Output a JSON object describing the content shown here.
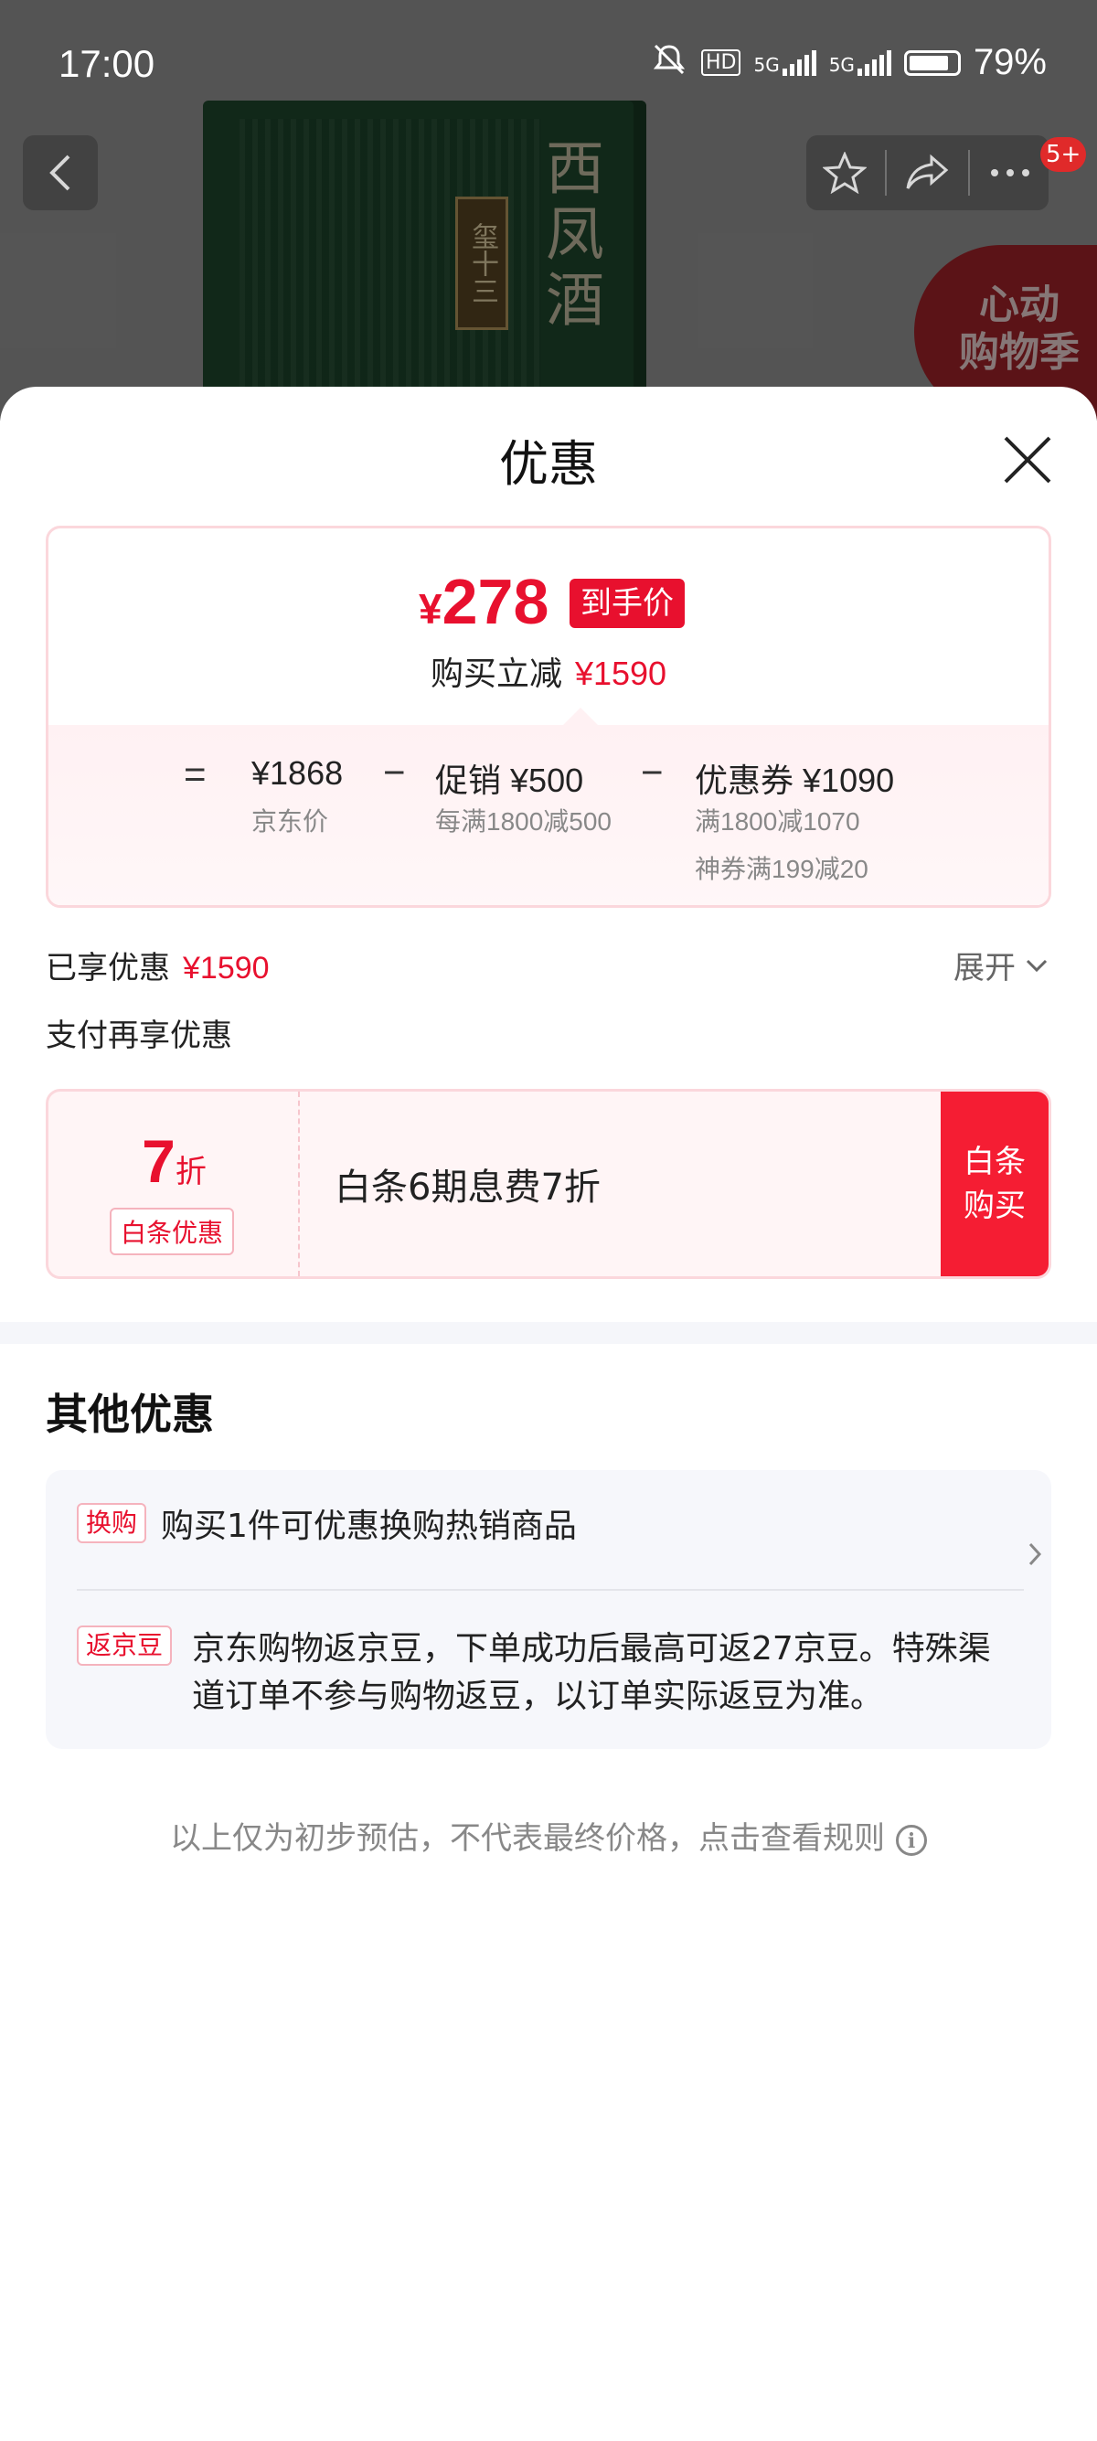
{
  "status_bar": {
    "time": "17:00",
    "network_hd": "HD",
    "network_5g_1": "5G",
    "network_5g_2": "5G",
    "battery": "79%"
  },
  "background": {
    "product_label": "玺十三",
    "product_name": "西凤酒",
    "message_badge": "5+",
    "promo_badge_line1": "心动",
    "promo_badge_line2": "购物季"
  },
  "sheet": {
    "title": "优惠",
    "price_card": {
      "currency": "¥",
      "final_price": "278",
      "final_tag": "到手价",
      "reduce_label": "购买立减",
      "reduce_amount": "¥1590",
      "equals": "=",
      "minus": "−",
      "jd_price": "¥1868",
      "jd_price_label": "京东价",
      "promo_label": "促销",
      "promo_amount": "¥500",
      "promo_rule": "每满1800减500",
      "coupon_label": "优惠券",
      "coupon_amount": "¥1090",
      "coupon_rule_1": "满1800减1070",
      "coupon_rule_2": "神券满199减20"
    },
    "enjoyed_label": "已享优惠",
    "enjoyed_amount": "¥1590",
    "expand_label": "展开",
    "pay_title": "支付再享优惠",
    "baitiao": {
      "discount_number": "7",
      "discount_unit": "折",
      "tag": "白条优惠",
      "text": "白条6期息费7折",
      "button_line1": "白条",
      "button_line2": "购买"
    },
    "other_title": "其他优惠",
    "other_items": [
      {
        "tag": "换购",
        "text": "购买1件可优惠换购热销商品"
      },
      {
        "tag": "返京豆",
        "text": "京东购物返京豆，下单成功后最高可返27京豆。特殊渠道订单不参与购物返豆，以订单实际返豆为准。"
      }
    ],
    "disclaimer": "以上仅为初步预估，不代表最终价格，点击查看规则"
  },
  "colors": {
    "accent_red": "#e8102e",
    "button_red": "#f51d33",
    "card_border": "#fbd7dc"
  }
}
